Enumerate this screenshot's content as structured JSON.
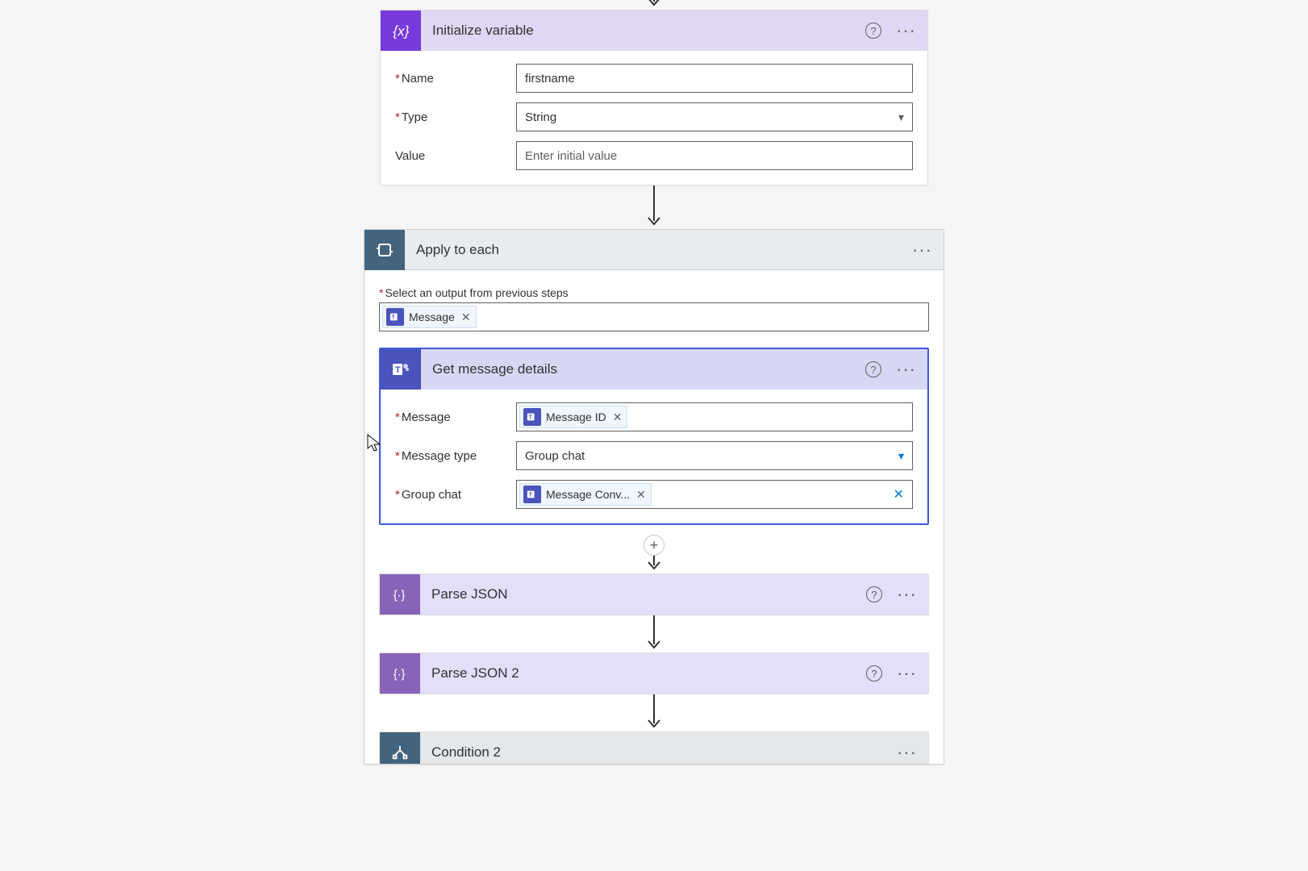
{
  "initVar": {
    "title": "Initialize variable",
    "nameLabel": "Name",
    "nameValue": "firstname",
    "typeLabel": "Type",
    "typeValue": "String",
    "valueLabel": "Value",
    "valuePlaceholder": "Enter initial value"
  },
  "applyToEach": {
    "title": "Apply to each",
    "selectLabel": "Select an output from previous steps",
    "tokenLabel": "Message"
  },
  "getMessageDetails": {
    "title": "Get message details",
    "messageLabel": "Message",
    "messageToken": "Message ID",
    "messageTypeLabel": "Message type",
    "messageTypeValue": "Group chat",
    "groupChatLabel": "Group chat",
    "groupChatToken": "Message Conv..."
  },
  "parseJson1": {
    "title": "Parse JSON"
  },
  "parseJson2": {
    "title": "Parse JSON 2"
  },
  "condition2": {
    "title": "Condition 2"
  }
}
